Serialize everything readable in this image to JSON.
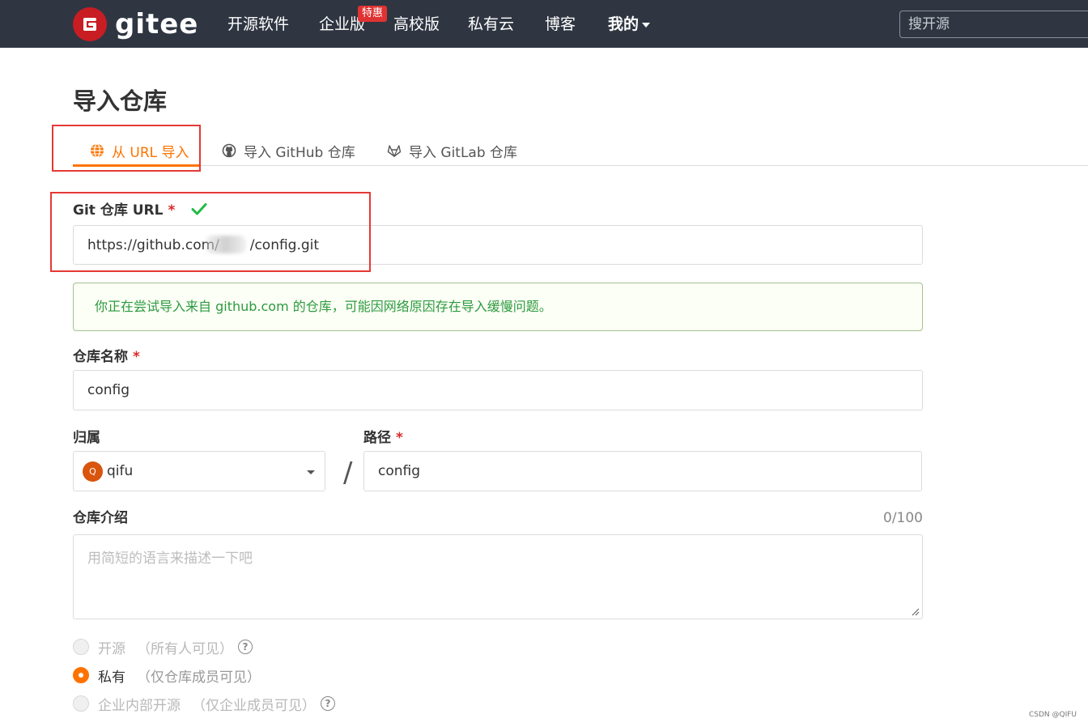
{
  "header": {
    "brand": "gitee",
    "nav": [
      "开源软件",
      "企业版",
      "高校版",
      "私有云",
      "博客",
      "我的"
    ],
    "badge": "特惠",
    "search_placeholder": "搜开源"
  },
  "page": {
    "title": "导入仓库"
  },
  "tabs": [
    {
      "label": "从 URL 导入",
      "icon": "globe-icon",
      "active": true
    },
    {
      "label": "导入 GitHub 仓库",
      "icon": "github-icon",
      "active": false
    },
    {
      "label": "导入 GitLab 仓库",
      "icon": "gitlab-icon",
      "active": false
    }
  ],
  "form": {
    "url_label": "Git 仓库 URL",
    "required_mark": "*",
    "url_value": "https://github.com/       /config.git",
    "notice": "你正在尝试导入来自 github.com 的仓库，可能因网络原因存在导入缓慢问题。",
    "name_label": "仓库名称",
    "name_value": "config",
    "owner_label": "归属",
    "owner_avatar": "Q",
    "owner_value": "qifu",
    "slash": "/",
    "path_label": "路径",
    "path_value": "config",
    "desc_label": "仓库介绍",
    "desc_counter": "0/100",
    "desc_placeholder": "用简短的语言来描述一下吧",
    "visibility": [
      {
        "label": "开源",
        "sub": "（所有人可见）",
        "selected": false,
        "disabled": true,
        "help": "?"
      },
      {
        "label": "私有",
        "sub": "（仅仓库成员可见）",
        "selected": true,
        "disabled": false
      },
      {
        "label": "企业内部开源",
        "sub": "（仅企业成员可见）",
        "selected": false,
        "disabled": true,
        "help": "?"
      }
    ]
  },
  "watermark": "CSDN @QIFU",
  "colors": {
    "accent": "#fe7300",
    "header_bg": "#2f3642",
    "brand_red": "#c71d23",
    "success_green": "#2c9a40",
    "annotation_red": "#e53935"
  }
}
